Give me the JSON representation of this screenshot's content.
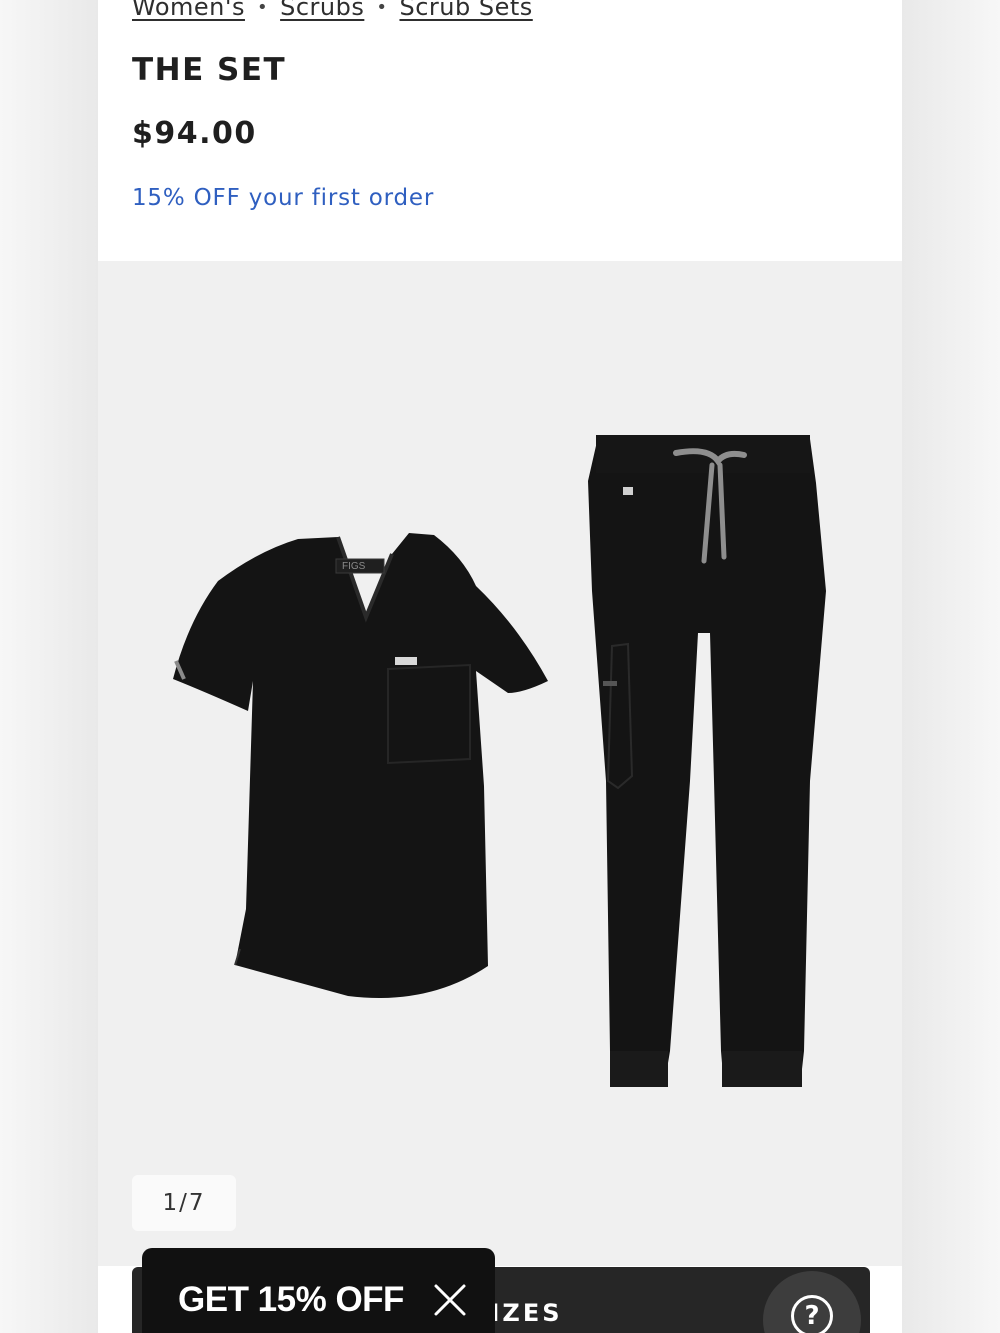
{
  "breadcrumb": {
    "items": [
      "Women's",
      "Scrubs",
      "Scrub Sets"
    ],
    "separator": "•"
  },
  "product": {
    "name": "THE SET",
    "price": "$94.00",
    "promo": "15% OFF your first order",
    "promo_color": "#2f5fc0"
  },
  "gallery": {
    "counter": "1/7",
    "image_brand_tag": "FIGS"
  },
  "size_bar": {
    "label": "SELECT SIZES",
    "visible_label": "T SIZES",
    "help_icon": "question-icon"
  },
  "promo_toast": {
    "label": "GET 15% OFF",
    "close_icon": "close-icon"
  },
  "colors": {
    "page_bg": "#ffffff",
    "gallery_bg": "#f0f0f0",
    "bar_bg": "#262626",
    "toast_bg": "#111111",
    "garment": "#141414",
    "drawstring": "#8e8e8e"
  }
}
